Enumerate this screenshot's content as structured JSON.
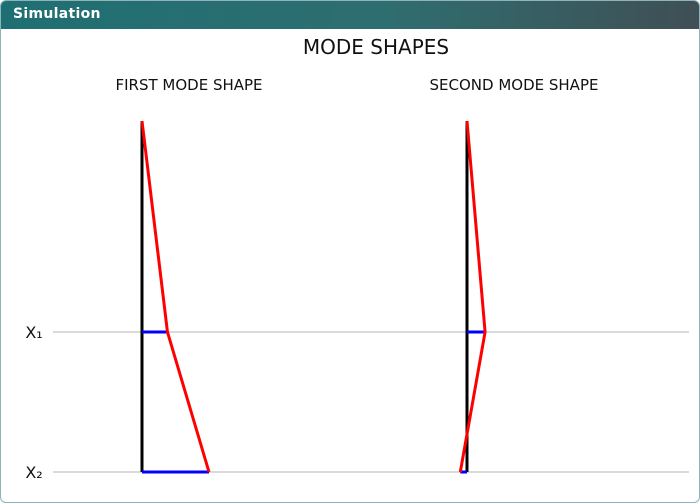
{
  "window": {
    "title": "Simulation"
  },
  "figure": {
    "title": "MODE SHAPES",
    "level_labels": [
      "X₁",
      "X₂"
    ],
    "modes": [
      {
        "title": "FIRST MODE SHAPE",
        "amplitude_x1": 0.38,
        "amplitude_x2": 1.0,
        "amplitude_top": 0.0
      },
      {
        "title": "SECOND MODE SHAPE",
        "amplitude_x1": 0.27,
        "amplitude_x2": -0.1,
        "amplitude_top": 0.0
      }
    ]
  },
  "colors": {
    "header_start": "#1e6f73",
    "header_end": "#3f4f55",
    "axis": "#000000",
    "displacement": "#0000ff",
    "mode_shape": "#ff0000",
    "level_line": "#b4b4b4"
  }
}
